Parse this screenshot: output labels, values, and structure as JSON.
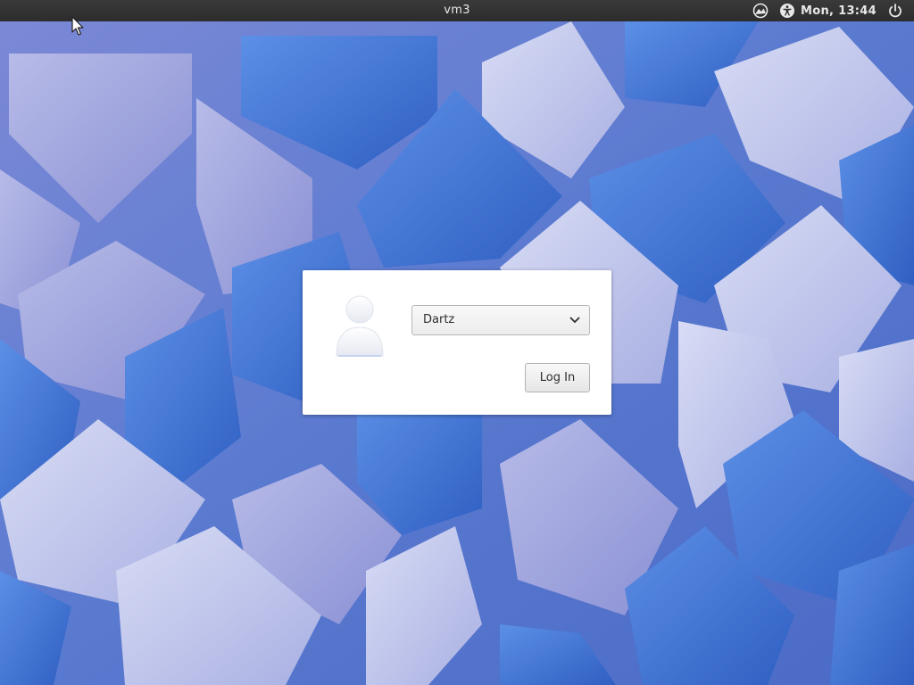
{
  "panel": {
    "hostname": "vm3",
    "clock": "Mon, 13:44",
    "icons": [
      "network-status-icon",
      "accessibility-icon",
      "power-icon"
    ]
  },
  "login": {
    "selected_user": "Dartz",
    "login_label": "Log In",
    "avatar_icon": "user-avatar-icon"
  },
  "colors": {
    "panel_bg": "#2f2f2f",
    "panel_text": "#e8e8e8",
    "dialog_bg": "#ffffff",
    "wallpaper_light": "#c9cdee",
    "wallpaper_blue": "#3a72d4",
    "wallpaper_dark": "#2c4fa8"
  }
}
